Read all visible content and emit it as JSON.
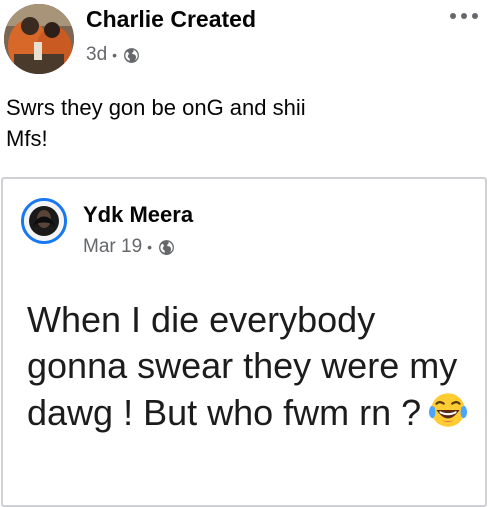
{
  "post": {
    "author_name": "Charlie Created",
    "timestamp": "3d",
    "separator": "•",
    "audience_icon": "globe-icon",
    "more_icon": "more-options-icon",
    "text": "Swrs they gon be onG and shii\nMfs!"
  },
  "shared_post": {
    "author_name": "Ydk Meera",
    "timestamp": "Mar 19",
    "separator": "•",
    "audience_icon": "globe-icon",
    "text": "When I die everybody gonna  swear they were my dawg ! But who fwm rn ?",
    "emoji": "face-with-tears-of-joy-icon"
  },
  "colors": {
    "text": "#050505",
    "secondary_text": "#65676b",
    "card_border": "#ced0d4",
    "story_ring": "#1877f2"
  }
}
